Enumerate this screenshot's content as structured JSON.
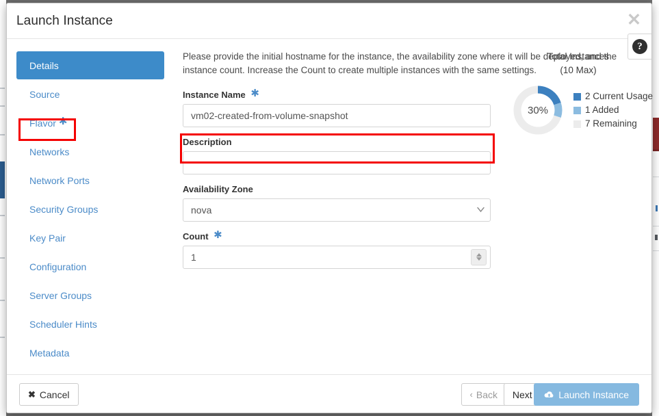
{
  "window": {
    "title": "Launch Instance",
    "close_icon": "close-icon",
    "help_icon": "question-mark-icon",
    "help_glyph": "?"
  },
  "wizard_nav": {
    "items": [
      {
        "label": "Details",
        "required": false,
        "active": true
      },
      {
        "label": "Source",
        "required": false,
        "active": false
      },
      {
        "label": "Flavor",
        "required": true,
        "active": false
      },
      {
        "label": "Networks",
        "required": false,
        "active": false
      },
      {
        "label": "Network Ports",
        "required": false,
        "active": false
      },
      {
        "label": "Security Groups",
        "required": false,
        "active": false
      },
      {
        "label": "Key Pair",
        "required": false,
        "active": false
      },
      {
        "label": "Configuration",
        "required": false,
        "active": false
      },
      {
        "label": "Server Groups",
        "required": false,
        "active": false
      },
      {
        "label": "Scheduler Hints",
        "required": false,
        "active": false
      },
      {
        "label": "Metadata",
        "required": false,
        "active": false
      }
    ]
  },
  "form": {
    "description": "Please provide the initial hostname for the instance, the availability zone where it will be deployed, and the instance count. Increase the Count to create multiple instances with the same settings.",
    "instance_name": {
      "label": "Instance Name",
      "required_marker": "*",
      "value": "vm02-created-from-volume-snapshot",
      "placeholder": "vm02-created-from-volume-snapshot"
    },
    "description_field": {
      "label": "Description",
      "value": "",
      "placeholder": ""
    },
    "availability_zone": {
      "label": "Availability Zone",
      "selected": "nova",
      "options": [
        "nova"
      ],
      "chevron_icon": "chevron-down-icon"
    },
    "count": {
      "label": "Count",
      "required_marker": "*",
      "value": "1",
      "spinner_up_icon": "caret-up-icon",
      "spinner_down_icon": "caret-down-icon"
    }
  },
  "quota": {
    "title_line1": "Total Instances",
    "title_line2": "(10 Max)",
    "percent_label": "30%"
  },
  "chart_data": {
    "type": "pie",
    "title": "Total Instances (10 Max)",
    "center_label": "30%",
    "max": 10,
    "categories": [
      "Current Usage",
      "Added",
      "Remaining"
    ],
    "values": [
      2,
      1,
      7
    ],
    "colors": [
      "#3c80bf",
      "#8cbce0",
      "#ececec"
    ],
    "legend": [
      {
        "swatch": "#3c80bf",
        "text": "2 Current Usage"
      },
      {
        "swatch": "#8cbce0",
        "text": "1 Added"
      },
      {
        "swatch": "#ececec",
        "text": "7 Remaining"
      }
    ],
    "legend_position": "right",
    "donut": true,
    "start_angle_deg": 0
  },
  "footer": {
    "cancel": {
      "label": "Cancel",
      "icon": "x-icon",
      "glyph": "✖"
    },
    "back": {
      "label": "Back",
      "icon": "chevron-left-icon",
      "glyph": "‹",
      "disabled": true
    },
    "next": {
      "label": "Next",
      "icon": "chevron-right-icon",
      "glyph": "›"
    },
    "launch": {
      "label": "Launch Instance",
      "icon": "cloud-upload-icon"
    }
  },
  "annotations": [
    {
      "name": "highlight-source-nav",
      "color": "#f40000"
    },
    {
      "name": "highlight-instance-name-input",
      "color": "#f40000"
    }
  ],
  "colors": {
    "accent_blue": "#3d8bc9",
    "link_blue": "#4b8bc8",
    "launch_blue": "#85b9e0",
    "annotation_red": "#f40000"
  }
}
